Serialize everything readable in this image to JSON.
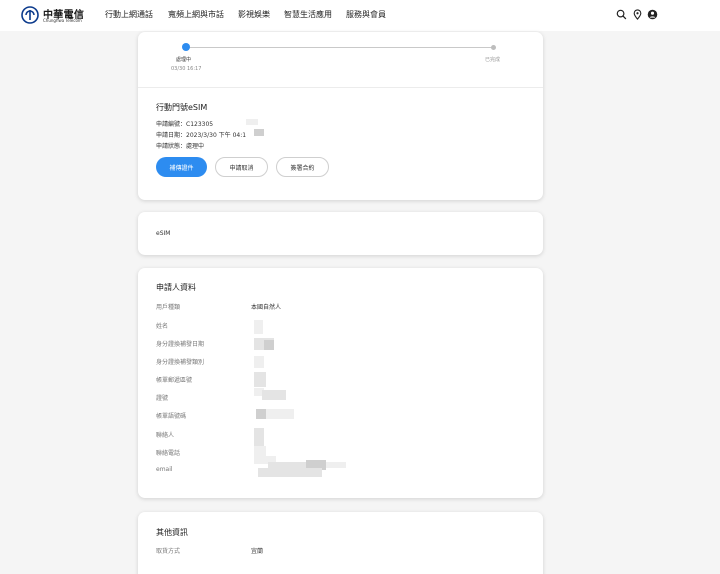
{
  "header": {
    "logo_cn": "中華電信",
    "logo_en": "Chunghwa Telecom",
    "nav": [
      "行動上網通話",
      "寬頻上網與市話",
      "影視娛樂",
      "智慧生活應用",
      "服務與會員"
    ],
    "icons": [
      "search-icon",
      "location-pin-icon",
      "user-account-icon"
    ]
  },
  "progress": {
    "step1_label": "處理中",
    "step1_time": "03/30 16:17",
    "step2_label": "已完成"
  },
  "order": {
    "title": "行動門號eSIM",
    "app_no": "申請編號：C123305",
    "app_date": "申請日期：2023/3/30 下午 04:1",
    "app_status": "申請狀態：處理中",
    "buttons": {
      "supplement": "補傳證件",
      "cancel": "申請取消",
      "contract": "簽署合約"
    }
  },
  "product": {
    "label": "eSIM"
  },
  "applicant": {
    "title": "申請人資料",
    "rows": [
      {
        "label": "用戶種類",
        "value": "本國自然人"
      },
      {
        "label": "姓名",
        "value": ""
      },
      {
        "label": "身分證換補發日期",
        "value": ""
      },
      {
        "label": "身分證換補發類別",
        "value": ""
      },
      {
        "label": "帳單郵遞區號",
        "value": ""
      },
      {
        "label": "證號",
        "value": ""
      },
      {
        "label": "帳單語號碼",
        "value": ""
      },
      {
        "label": "聯絡人",
        "value": ""
      },
      {
        "label": "聯絡電話",
        "value": ""
      },
      {
        "label": "email",
        "value": ""
      }
    ]
  },
  "other": {
    "title": "其他資訊",
    "rows": [
      {
        "label": "取貨方式",
        "value": "宜蘭"
      }
    ]
  },
  "colors": {
    "primary": "#2d8cf0",
    "background": "#f5f5f5"
  }
}
